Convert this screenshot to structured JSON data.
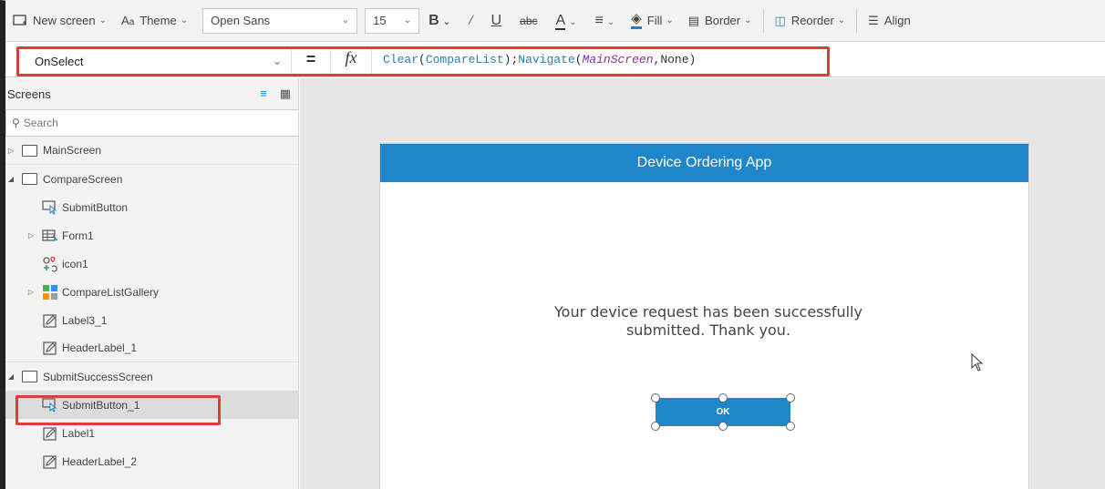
{
  "toolbar": {
    "new_screen_label": "New screen",
    "theme_label": "Theme",
    "font_value": "Open Sans",
    "size_value": "15",
    "fill_label": "Fill",
    "border_label": "Border",
    "reorder_label": "Reorder",
    "align_label": "Align"
  },
  "formula": {
    "property": "OnSelect",
    "equals": "=",
    "fx": "fx",
    "fn1": "Clear",
    "p1": "(",
    "arg1": "CompareList",
    "p2": ");",
    "fn2": "Navigate",
    "p3": "(",
    "arg2": "MainScreen",
    "p4": ",None)"
  },
  "panel": {
    "title": "Screens",
    "search_placeholder": "Search",
    "tree": [
      {
        "label": "MainScreen"
      },
      {
        "label": "CompareScreen"
      },
      {
        "label": "SubmitButton"
      },
      {
        "label": "Form1"
      },
      {
        "label": "icon1"
      },
      {
        "label": "CompareListGallery"
      },
      {
        "label": "Label3_1"
      },
      {
        "label": "HeaderLabel_1"
      },
      {
        "label": "SubmitSuccessScreen"
      },
      {
        "label": "SubmitButton_1"
      },
      {
        "label": "Label1"
      },
      {
        "label": "HeaderLabel_2"
      }
    ]
  },
  "app": {
    "header_title": "Device Ordering App",
    "message": "Your device request has been successfully submitted. Thank you.",
    "ok_label": "OK"
  },
  "colors": {
    "accent": "#1f87c9",
    "highlight": "#e03c3c"
  }
}
